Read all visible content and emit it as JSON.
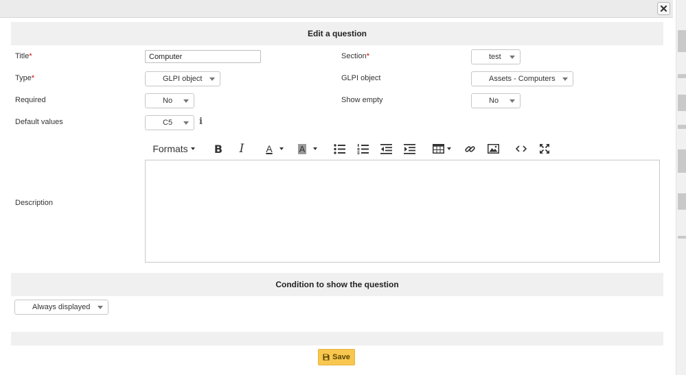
{
  "dialog": {
    "close_label": "×"
  },
  "section1": {
    "title": "Edit a question"
  },
  "fields": {
    "title_label": "Title",
    "title_value": "Computer",
    "section_label": "Section",
    "section_value": "test",
    "type_label": "Type",
    "type_value": "GLPI object",
    "glpi_object_label": "GLPI object",
    "glpi_object_value": "Assets - Computers",
    "required_label": "Required",
    "required_value": "No",
    "show_empty_label": "Show empty",
    "show_empty_value": "No",
    "default_values_label": "Default values",
    "default_values_value": "C5",
    "description_label": "Description",
    "required_marker": "*",
    "info_glyph": "i"
  },
  "toolbar": {
    "formats_label": "Formats",
    "bold_glyph": "B",
    "italic_glyph": "I",
    "text_color_glyph": "A",
    "bg_color_glyph": "A"
  },
  "section2": {
    "title": "Condition to show the question"
  },
  "condition": {
    "value": "Always displayed"
  },
  "footer": {
    "save_label": "Save"
  },
  "colors": {
    "accent_save": "#f8c74f",
    "header_bg": "#f0f0f0",
    "required_marker": "#cc0000"
  },
  "icons": [
    "close-icon",
    "bold-icon",
    "italic-icon",
    "text-color-icon",
    "background-color-icon",
    "bullet-list-icon",
    "numbered-list-icon",
    "outdent-icon",
    "indent-icon",
    "table-icon",
    "link-icon",
    "image-icon",
    "code-icon",
    "fullscreen-icon",
    "info-icon",
    "save-disk-icon"
  ]
}
